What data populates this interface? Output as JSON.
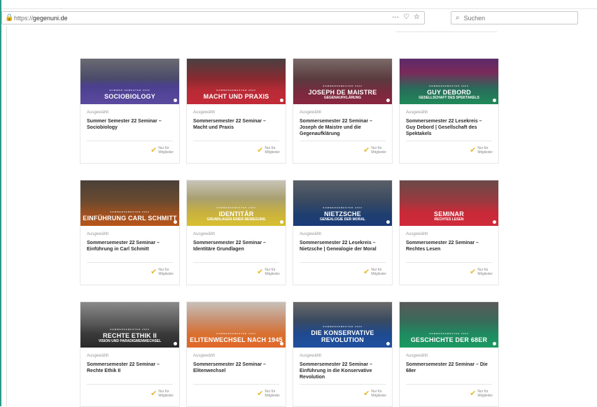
{
  "browser": {
    "url_protocol": "https://",
    "url_host": "gegenuni.de",
    "actions": [
      "···",
      "♡",
      "☆"
    ],
    "search_placeholder": "Suchen"
  },
  "colors": {
    "accent": "#2a9a8a",
    "badge_icon": "#e8b930"
  },
  "cards": [
    {
      "thumb_sup": "SUMMER SEMESTER 2022",
      "thumb_title": "SOCIOBIOLOGY",
      "thumb_sub": "",
      "thumb_bg": "linear-gradient(180deg,#6a6a72 0%,#4a4a6a 45%,#4b3f8f 60%,#5b4a9f 100%)",
      "badge": "Ausgewählt",
      "title": "Summer Semester 22 Seminar – Sociobiology",
      "members_l1": "Nur für",
      "members_l2": "Mitglieder"
    },
    {
      "thumb_sup": "SOMMERSEMESTER 2022",
      "thumb_title": "MACHT UND PRAXIS",
      "thumb_sub": "",
      "thumb_bg": "linear-gradient(180deg,#4a4042 0%,#8a2a30 45%,#b82a35 70%,#c42a38 100%)",
      "badge": "Ausgewählt",
      "title": "Sommersemester 22 Seminar – Macht und Praxis",
      "members_l1": "Nur für",
      "members_l2": "Mitglieder"
    },
    {
      "thumb_sup": "SOMMERSEMESTER 2022",
      "thumb_title": "JOSEPH DE MAISTRE",
      "thumb_sub": "GEGENAUFKLÄRUNG",
      "thumb_bg": "linear-gradient(180deg,#7a6a68 0%,#5a3a3e 45%,#7a2a3e 75%,#8a2540 100%)",
      "badge": "Ausgewählt",
      "title": "Sommersemester 22 Seminar – Joseph de Maistre und die Gegenaufklärung",
      "members_l1": "Nur für",
      "members_l2": "Mitglieder"
    },
    {
      "thumb_sup": "SOMMERSEMESTER 2022",
      "thumb_title": "GUY DEBORD",
      "thumb_sub": "GESELLSCHAFT DES SPEKTAKELS",
      "thumb_bg": "linear-gradient(180deg,#5a2a6a 0%,#7a2a5a 30%,#2a6a5a 65%,#1f8a5a 100%)",
      "badge": "Ausgewählt",
      "title": "Sommersemester 22 Lesekreis – Guy Debord | Gesellschaft des Spektakels",
      "members_l1": "Nur für",
      "members_l2": "Mitglieder"
    },
    {
      "thumb_sup": "SOMMERSEMESTER 2022",
      "thumb_title": "EINFÜHRUNG CARL SCHMITT",
      "thumb_sub": "",
      "thumb_bg": "linear-gradient(180deg,#4a4038 0%,#6a4a30 45%,#a0501f 75%,#b8561a 100%)",
      "badge": "Ausgewählt",
      "title": "Sommersemester 22 Seminar – Einführung in Carl Schmitt",
      "members_l1": "Nur für",
      "members_l2": "Mitglieder"
    },
    {
      "thumb_sup": "SOMMERSEMESTER 2022",
      "thumb_title": "IDENTITÄR",
      "thumb_sub": "GRUNDLAGEN EINER BEWEGUNG",
      "thumb_bg": "linear-gradient(180deg,#c8c4b8 0%,#a8a070 40%,#c8b040 70%,#d8c030 100%)",
      "badge": "Ausgewählt",
      "title": "Sommersemester 22 Seminar – Identitäre Grundlagen",
      "members_l1": "Nur für",
      "members_l2": "Mitglieder"
    },
    {
      "thumb_sup": "SOMMERSEMESTER 2022",
      "thumb_title": "NIETZSCHE",
      "thumb_sub": "GENEALOGIE DER MORAL",
      "thumb_bg": "linear-gradient(180deg,#5a6068 0%,#3a4a60 45%,#1f3f70 75%,#1a3a78 100%)",
      "badge": "Ausgewählt",
      "title": "Sommersemester 22 Lesekreis – Nietzsche | Genealogie der Moral",
      "members_l1": "Nur für",
      "members_l2": "Mitglieder"
    },
    {
      "thumb_sup": "",
      "thumb_title": "SEMINAR",
      "thumb_sub": "RECHTES LESEN",
      "thumb_bg": "linear-gradient(180deg,#6a4a48 0%,#9a3a40 45%,#c82a38 70%,#d02a3a 100%)",
      "badge": "Ausgewählt",
      "title": "Sommersemester 22 Seminar – Rechtes Lesen",
      "members_l1": "Nur für",
      "members_l2": "Mitglieder"
    },
    {
      "thumb_sup": "SOMMERSEMESTER 2022",
      "thumb_title": "RECHTE ETHIK II",
      "thumb_sub": "VISION UND PARADIGMENWECHSEL",
      "thumb_bg": "linear-gradient(180deg,#8a8a8a 0%,#5a5a5a 45%,#3a3a3a 70%,#2a2a2a 100%)",
      "badge": "Ausgewählt",
      "title": "Sommersemester 22 Seminar – Rechte Ethik II",
      "members_l1": "Nur für",
      "members_l2": "Mitglieder"
    },
    {
      "thumb_sup": "SOMMERSEMESTER 2022",
      "thumb_title": "ELITENWECHSEL NACH 1945",
      "thumb_sub": "",
      "thumb_bg": "linear-gradient(180deg,#c8c0b8 0%,#c89070 40%,#d87030 70%,#e0682a 100%)",
      "badge": "Ausgewählt",
      "title": "Sommersemester 22 Seminar – Elitenwechsel",
      "members_l1": "Nur für",
      "members_l2": "Mitglieder"
    },
    {
      "thumb_sup": "SOMMERSEMESTER 2022",
      "thumb_title": "DIE KONSERVATIVE REVOLUTION",
      "thumb_sub": "",
      "thumb_bg": "linear-gradient(180deg,#6a6a6a 0%,#3a4a60 40%,#1f4a90 70%,#1f50a0 100%)",
      "badge": "Ausgewählt",
      "title": "Sommersemester 22 Seminar – Einführung in die Konservative Revolution",
      "members_l1": "Nur für",
      "members_l2": "Mitglieder"
    },
    {
      "thumb_sup": "SOMMERSEMESTER 2022",
      "thumb_title": "Geschichte der 68er",
      "thumb_sub": "",
      "thumb_bg": "linear-gradient(180deg,#5a5a5a 0%,#3a6a5a 40%,#1f8a60 70%,#1a9a62 100%)",
      "badge": "Ausgewählt",
      "title": "Sommersemester 22 Seminar – Die 68er",
      "members_l1": "Nur für",
      "members_l2": "Mitglieder"
    }
  ]
}
